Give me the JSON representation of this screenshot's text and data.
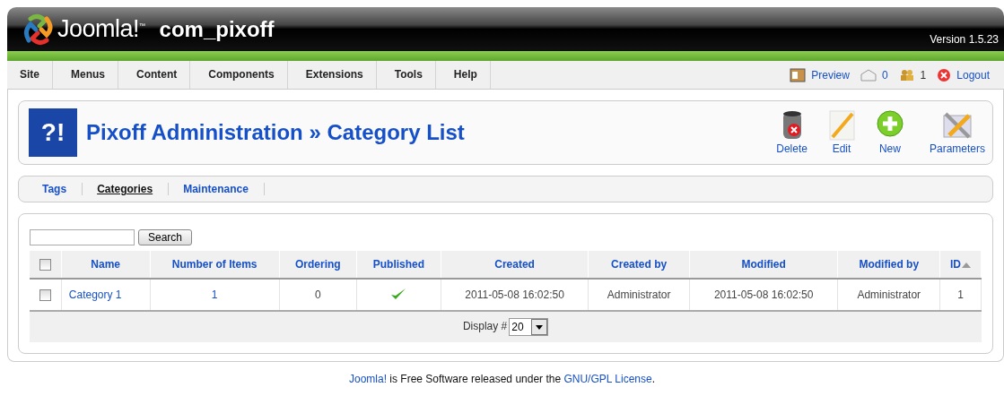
{
  "header": {
    "logo_text": "Joomla!",
    "logo_mark": "™",
    "title": "com_pixoff",
    "version": "Version 1.5.23"
  },
  "menu": [
    {
      "label": "Site"
    },
    {
      "label": "Menus"
    },
    {
      "label": "Content"
    },
    {
      "label": "Components"
    },
    {
      "label": "Extensions"
    },
    {
      "label": "Tools"
    },
    {
      "label": "Help"
    }
  ],
  "status": {
    "preview": "Preview",
    "messages": "0",
    "users": "1",
    "logout": "Logout"
  },
  "toolbar": {
    "badge": "?!",
    "title": "Pixoff Administration » Category List",
    "buttons": [
      {
        "label": "Delete",
        "kind": "delete"
      },
      {
        "label": "Edit",
        "kind": "edit"
      },
      {
        "label": "New",
        "kind": "new"
      },
      {
        "label": "Parameters",
        "kind": "parameters"
      }
    ]
  },
  "submenu": [
    {
      "label": "Tags",
      "selected": false
    },
    {
      "label": "Categories",
      "selected": true
    },
    {
      "label": "Maintenance",
      "selected": false
    }
  ],
  "search": {
    "button": "Search"
  },
  "table": {
    "all_checked": false,
    "columns": [
      {
        "label": "Name",
        "sorted": false
      },
      {
        "label": "Number of Items",
        "sorted": false
      },
      {
        "label": "Ordering",
        "sorted": false
      },
      {
        "label": "Published",
        "sorted": false
      },
      {
        "label": "Created",
        "sorted": false
      },
      {
        "label": "Created by",
        "sorted": false
      },
      {
        "label": "Modified",
        "sorted": false
      },
      {
        "label": "Modified by",
        "sorted": false
      },
      {
        "label": "ID",
        "sorted": true
      }
    ],
    "rows": [
      {
        "checked": false,
        "name": "Category 1",
        "items": "1",
        "ordering": "0",
        "published": true,
        "created": "2011-05-08 16:02:50",
        "created_by": "Administrator",
        "modified": "2011-05-08 16:02:50",
        "modified_by": "Administrator",
        "id": "1"
      }
    ]
  },
  "pagination": {
    "label": "Display #",
    "value": "20"
  },
  "footer": {
    "link_1": "Joomla!",
    "text": " is Free Software released under the ",
    "link_2": "GNU/GPL License",
    "end": "."
  }
}
